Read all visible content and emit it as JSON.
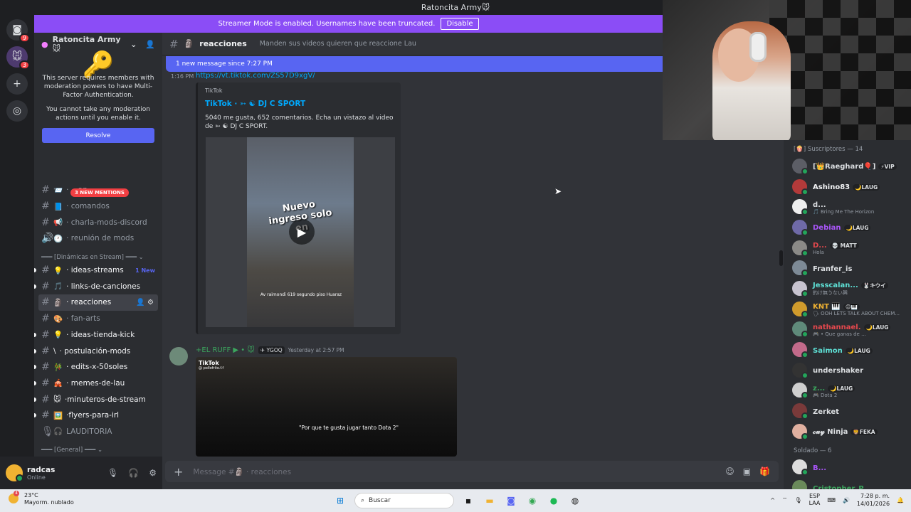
{
  "window": {
    "title": "Ratoncita Army🐭"
  },
  "banner": {
    "text": "Streamer Mode is enabled. Usernames have been truncated.",
    "button": "Disable"
  },
  "guilds": {
    "home_badge": "9",
    "server_badge": "3"
  },
  "server": {
    "name": "Ratoncita Army🐭",
    "mfa_text1": "This server requires members with moderation powers to have Multi-Factor Authentication.",
    "mfa_text2": "You cannot take any moderation actions until you enable it.",
    "resolve": "Resolve",
    "mentions": "3 NEW MENTIONS"
  },
  "channels": [
    {
      "emoji": "📨",
      "name": "· ...az",
      "style": "muted",
      "icon": "#"
    },
    {
      "emoji": "📘",
      "name": "· comandos",
      "style": "muted",
      "icon": "#"
    },
    {
      "emoji": "📢",
      "name": "· charla-mods-discord",
      "style": "muted",
      "icon": "#"
    },
    {
      "emoji": "🕐",
      "name": "· reunión de mods",
      "style": "muted",
      "icon": "🔊"
    }
  ],
  "category1": "━━━ [Dinámicas en Stream] ━━━ ⌄",
  "channels2": [
    {
      "emoji": "💡",
      "name": "· ideas-streams",
      "extra": "1 New",
      "icon": "#"
    },
    {
      "emoji": "🎵",
      "name": "· links-de-canciones",
      "icon": "#"
    },
    {
      "emoji": "🗿",
      "name": "· reacciones",
      "active": true,
      "icon": "#"
    },
    {
      "emoji": "🎨",
      "name": "· fan-arts",
      "muted": true,
      "icon": "#"
    },
    {
      "emoji": "💡",
      "name": "· ideas-tienda-kick",
      "icon": "#"
    },
    {
      "emoji": "\\",
      "name": "· postulación-mods",
      "icon": "#"
    },
    {
      "emoji": "🎋",
      "name": "· edits-x-50soles",
      "icon": "#"
    },
    {
      "emoji": "🎪",
      "name": "· memes-de-lau",
      "icon": "#"
    },
    {
      "emoji": "🐭",
      "name": "·minuteros-de-stream",
      "icon": "#"
    },
    {
      "emoji": "🖼️",
      "name": "·flyers-para-irl",
      "icon": "#"
    },
    {
      "emoji": "🎧",
      "name": "LAUDITORIA",
      "muted": true,
      "icon": "🎙"
    }
  ],
  "category2": "━━━ [General] ━━━ ⌄",
  "user": {
    "name": "radcas",
    "status": "Online"
  },
  "chat": {
    "channel": "reacciones",
    "topic": "Manden sus videos quieren que reaccione Lau",
    "new_messages": "1 new message since 7:27 PM",
    "msg1_time": "1:16 PM",
    "msg1_link": "https://vt.tiktok.com/ZS57D9xgV/",
    "embed_provider": "TikTok",
    "embed_title": "TikTok · ➳ ☯ DJ C SPORT",
    "embed_desc": "5040 me gusta, 652 comentarios. Echa un vistazo al video de ➳ ☯ DJ C SPORT.",
    "video_text": "Nuevo ingreso solo en",
    "video_sub": "Av raimondi 619 segundo piso Huaraz",
    "msg2_name": "+EL RUFF ▶ • 🐭",
    "msg2_tag": "✈ YGOQ",
    "msg2_time": "Yesterday at 2:57 PM",
    "video2_brand": "TikTok",
    "video2_handle": "@ pollofrito.f.f",
    "video2_caption": "\"Por que te gusta jugar tanto Dota 2\"",
    "composer_placeholder": "Message #🗿 · reacciones"
  },
  "members": {
    "header1": "[🍿] Suscriptores — 14",
    "list1": [
      {
        "name": "[👑Raeghard🎈]",
        "tag": "⚡VIP",
        "color": "#dbdee1",
        "avatar": "#5c5e66"
      },
      {
        "name": "Ashino83",
        "tag": "🌙LAUG",
        "color": "#f2f3f5",
        "avatar": "#b33a3a"
      },
      {
        "name": "d...",
        "activity": "🎵 Bring Me The Horizon",
        "color": "#dbdee1",
        "avatar": "#eeeeee"
      },
      {
        "name": "Debian",
        "tag": "🌙LAUG",
        "color": "#a855f7",
        "avatar": "#6f6aa8"
      },
      {
        "name": "D...",
        "tag": "💀 MATT",
        "activity": "Hola",
        "color": "#e5484d",
        "avatar": "#8b8a87"
      },
      {
        "name": "Franfer_is",
        "color": "#dbdee1",
        "avatar": "#7d8a96"
      },
      {
        "name": "Jesscalan...",
        "tag": "🐰キウイ",
        "activity": "釣け無うない興",
        "color": "#5ee1d6",
        "avatar": "#c7c3cf"
      },
      {
        "name": "KNT 🎹",
        "tag": "😊🎹",
        "activity": "🗣 OOH LETS TALK ABOUT CHEM...",
        "color": "#f0b232",
        "avatar": "#d09b2c"
      },
      {
        "name": "nathannael.",
        "tag": "🌙LAUG",
        "activity": "🎮 • Que ganas de ...",
        "color": "#e5484d",
        "avatar": "#5f8a7a"
      },
      {
        "name": "Saimon",
        "tag": "🌙LAUG",
        "color": "#5ee1d6",
        "avatar": "#c26a8a"
      },
      {
        "name": "undershaker",
        "color": "#dbdee1",
        "avatar": "#333333"
      },
      {
        "name": "z...",
        "tag": "🌙LAUG",
        "activity": "🎮 Dota 2",
        "color": "#3ba55d",
        "avatar": "#cfcfcf"
      },
      {
        "name": "Zerket",
        "color": "#dbdee1",
        "avatar": "#7a3a3a"
      },
      {
        "name": "𝓬𝓾𝔂 Ninja",
        "tag": "🦁FEKA",
        "color": "#dbdee1",
        "avatar": "#e0b0a0"
      }
    ],
    "header2": "Soldado — 6",
    "list2": [
      {
        "name": "B...",
        "color": "#a855f7",
        "avatar": "#dddddd"
      },
      {
        "name": "Cristopher_P...",
        "color": "#3ba55d",
        "avatar": "#6a8a5a"
      }
    ]
  },
  "taskbar": {
    "weather_count": "4",
    "temp": "23°C",
    "weather": "Mayorm. nublado",
    "search": "Buscar",
    "lang1": "ESP",
    "lang2": "LAA",
    "time": "7:28 p. m.",
    "date": "14/01/2026"
  }
}
